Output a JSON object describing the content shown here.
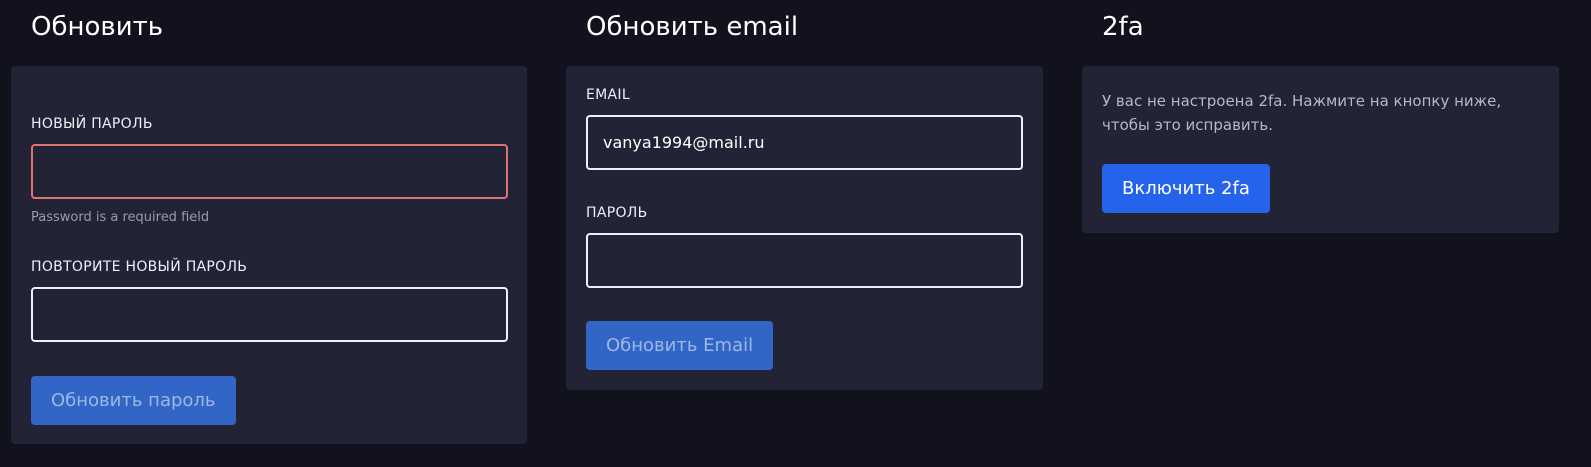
{
  "password_section": {
    "title": "Обновить",
    "new_password_label": "НОВЫЙ ПАРОЛЬ",
    "new_password_value": "",
    "new_password_error": "Password is a required field",
    "repeat_password_label": "ПОВТОРИТЕ НОВЫЙ ПАРОЛЬ",
    "repeat_password_value": "",
    "submit_label": "Обновить пароль"
  },
  "email_section": {
    "title": "Обновить email",
    "email_label": "EMAIL",
    "email_value": "vanya1994@mail.ru",
    "password_label": "ПАРОЛЬ",
    "password_value": "",
    "submit_label": "Обновить Email"
  },
  "twofa_section": {
    "title": "2fa",
    "description": "У вас не настроена 2fa. Нажмите на кнопку ниже, чтобы это исправить.",
    "enable_label": "Включить 2fa"
  },
  "colors": {
    "background": "#12121e",
    "card": "#222335",
    "error_border": "#e2726f",
    "primary_button": "#2563eb",
    "disabled_button": "#3166c6"
  }
}
